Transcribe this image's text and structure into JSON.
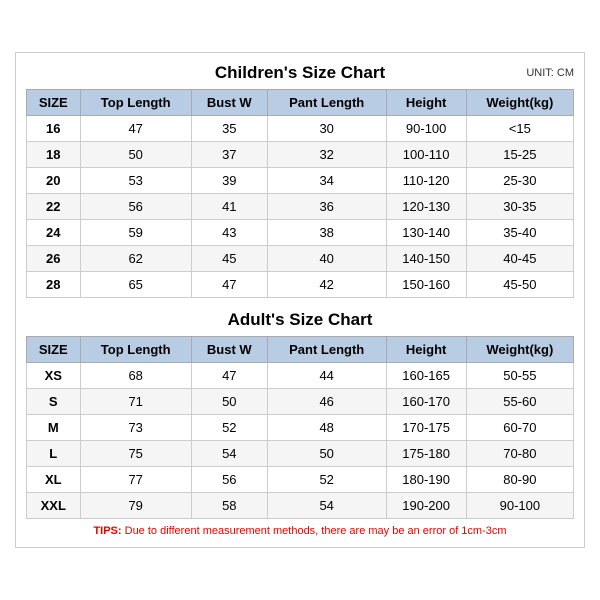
{
  "children": {
    "title": "Children's Size Chart",
    "unit": "UNIT: CM",
    "headers": [
      "SIZE",
      "Top Length",
      "Bust W",
      "Pant Length",
      "Height",
      "Weight(kg)"
    ],
    "rows": [
      [
        "16",
        "47",
        "35",
        "30",
        "90-100",
        "<15"
      ],
      [
        "18",
        "50",
        "37",
        "32",
        "100-110",
        "15-25"
      ],
      [
        "20",
        "53",
        "39",
        "34",
        "110-120",
        "25-30"
      ],
      [
        "22",
        "56",
        "41",
        "36",
        "120-130",
        "30-35"
      ],
      [
        "24",
        "59",
        "43",
        "38",
        "130-140",
        "35-40"
      ],
      [
        "26",
        "62",
        "45",
        "40",
        "140-150",
        "40-45"
      ],
      [
        "28",
        "65",
        "47",
        "42",
        "150-160",
        "45-50"
      ]
    ]
  },
  "adults": {
    "title": "Adult's Size Chart",
    "headers": [
      "SIZE",
      "Top Length",
      "Bust W",
      "Pant Length",
      "Height",
      "Weight(kg)"
    ],
    "rows": [
      [
        "XS",
        "68",
        "47",
        "44",
        "160-165",
        "50-55"
      ],
      [
        "S",
        "71",
        "50",
        "46",
        "160-170",
        "55-60"
      ],
      [
        "M",
        "73",
        "52",
        "48",
        "170-175",
        "60-70"
      ],
      [
        "L",
        "75",
        "54",
        "50",
        "175-180",
        "70-80"
      ],
      [
        "XL",
        "77",
        "56",
        "52",
        "180-190",
        "80-90"
      ],
      [
        "XXL",
        "79",
        "58",
        "54",
        "190-200",
        "90-100"
      ]
    ]
  },
  "tips": {
    "label": "TIPS:",
    "text": " Due to different measurement methods, there are may be an error of 1cm-3cm"
  }
}
